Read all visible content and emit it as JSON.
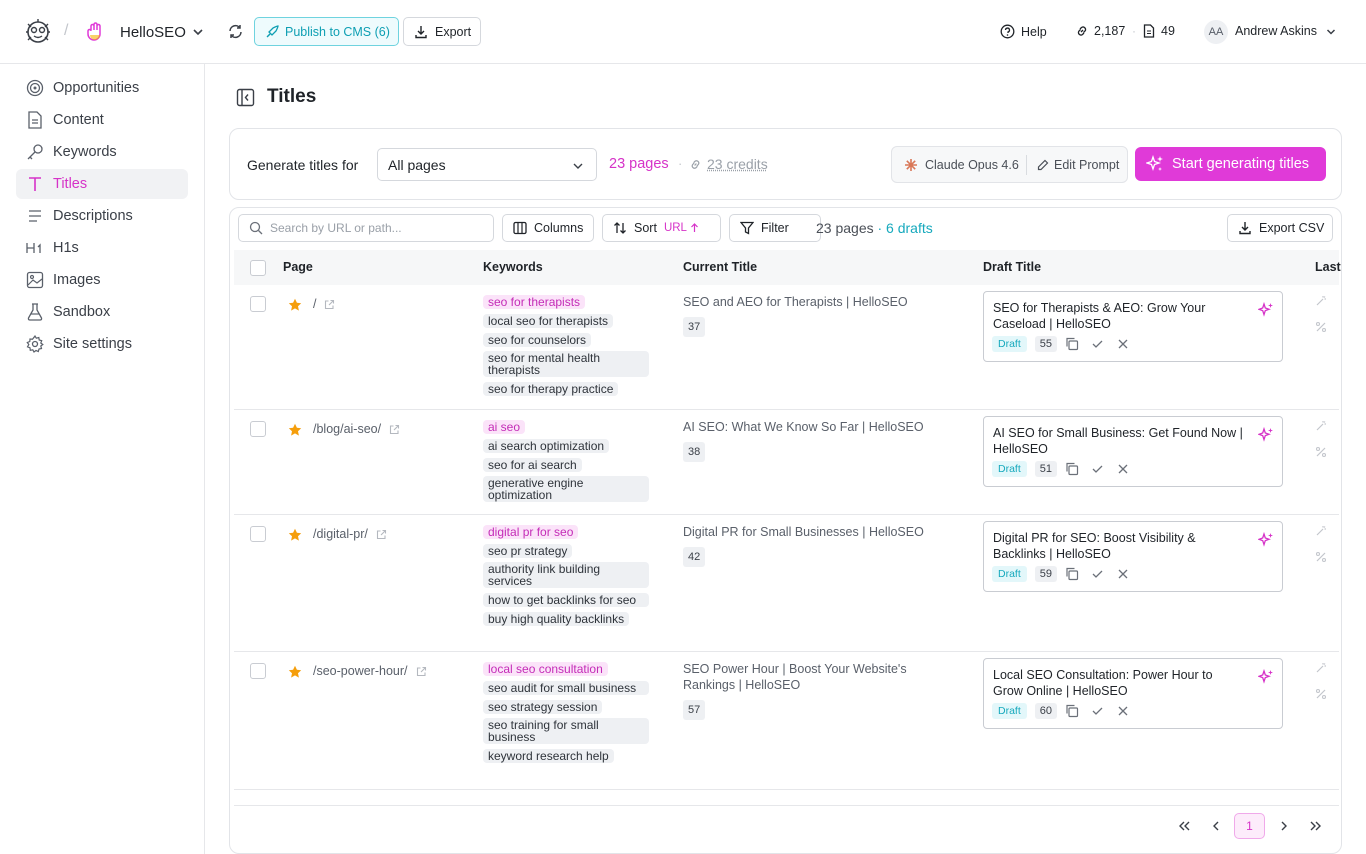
{
  "header": {
    "project_name": "HelloSEO",
    "publish_label": "Publish to CMS (6)",
    "export_label": "Export",
    "help_label": "Help",
    "links_count": "2,187",
    "pages_count": "49",
    "avatar_initials": "AA",
    "user_name": "Andrew Askins"
  },
  "sidebar": {
    "items": [
      {
        "label": "Opportunities",
        "icon": "target-icon"
      },
      {
        "label": "Content",
        "icon": "document-icon"
      },
      {
        "label": "Keywords",
        "icon": "key-icon"
      },
      {
        "label": "Titles",
        "icon": "title-icon"
      },
      {
        "label": "Descriptions",
        "icon": "lines-icon"
      },
      {
        "label": "H1s",
        "icon": "heading-icon"
      },
      {
        "label": "Images",
        "icon": "image-icon"
      },
      {
        "label": "Sandbox",
        "icon": "flask-icon"
      },
      {
        "label": "Site settings",
        "icon": "gear-icon"
      }
    ],
    "active": "Titles"
  },
  "main": {
    "title": "Titles",
    "generate": {
      "label": "Generate titles for",
      "selected": "All pages",
      "pages": "23 pages",
      "sep": "·",
      "credits": "23 credits",
      "model": "Claude Opus 4.6",
      "edit_prompt": "Edit Prompt",
      "start_label": "Start generating titles"
    },
    "toolbar": {
      "search_placeholder": "Search by URL or path...",
      "columns_label": "Columns",
      "sort_label": "Sort",
      "sort_value": "URL",
      "filter_label": "Filter",
      "count": "23 pages",
      "drafts": "· 6 drafts",
      "export_csv_label": "Export CSV"
    },
    "columns": {
      "page": "Page",
      "keywords": "Keywords",
      "current_title": "Current Title",
      "draft_title": "Draft Title",
      "last": "Last"
    },
    "rows": [
      {
        "path": "/",
        "keywords": [
          "seo for therapists",
          "local seo for therapists",
          "seo for counselors",
          "seo for mental health therapists",
          "seo for therapy practice"
        ],
        "current_title": "SEO and AEO for Therapists | HelloSEO",
        "current_len": "37",
        "draft_title": "SEO for Therapists & AEO: Grow Your Caseload | HelloSEO",
        "draft_badge": "Draft",
        "draft_len": "55"
      },
      {
        "path": "/blog/ai-seo/",
        "keywords": [
          "ai seo",
          "ai search optimization",
          "seo for ai search",
          "generative engine optimization"
        ],
        "current_title": "AI SEO: What We Know So Far | HelloSEO",
        "current_len": "38",
        "draft_title": "AI SEO for Small Business: Get Found Now | HelloSEO",
        "draft_badge": "Draft",
        "draft_len": "51"
      },
      {
        "path": "/digital-pr/",
        "keywords": [
          "digital pr for seo",
          "seo pr strategy",
          "authority link building services",
          "how to get backlinks for seo",
          "buy high quality backlinks"
        ],
        "current_title": "Digital PR for Small Businesses | HelloSEO",
        "current_len": "42",
        "draft_title": "Digital PR for SEO: Boost Visibility & Backlinks | HelloSEO",
        "draft_badge": "Draft",
        "draft_len": "59"
      },
      {
        "path": "/seo-power-hour/",
        "keywords": [
          "local seo consultation",
          "seo audit for small business",
          "seo strategy session",
          "seo training for small business",
          "keyword research help"
        ],
        "current_title": "SEO Power Hour | Boost Your Website's Rankings | HelloSEO",
        "current_len": "57",
        "draft_title": "Local SEO Consultation: Power Hour to Grow Online | HelloSEO",
        "draft_badge": "Draft",
        "draft_len": "60"
      }
    ],
    "pagination": {
      "current": "1"
    }
  },
  "colors": {
    "accent": "#d633c8",
    "teal": "#16a9bd",
    "star": "#f59e0b"
  }
}
